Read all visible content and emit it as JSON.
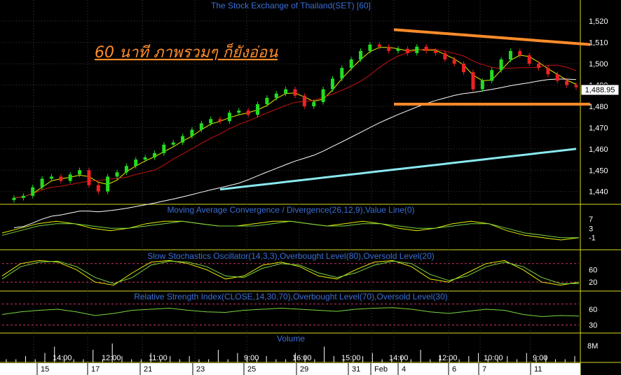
{
  "colors": {
    "background": "#000000",
    "frame": "#d8d820",
    "grid": "#3c3c3c",
    "up_candle": "#22dd22",
    "down_candle": "#ee2222",
    "ma_short": "#e8f000",
    "ma_mid": "#cc1111",
    "ma_long": "#ffffff",
    "ma_longest": "#8ae8f0",
    "trendline": "#ff8c2a",
    "indicator_line1": "#e8f000",
    "indicator_line2": "#7ad640",
    "level_line": "#cc3366",
    "title_text": "#3b6fd6"
  },
  "annotation": "60 นาที ภาพรวมๆ ก็ยังอ่อน",
  "chart_data": [
    {
      "type": "candlestick",
      "title": "The Stock Exchange of Thailand(SET) [60]",
      "y_ticks": [
        "1,520",
        "1,510",
        "1,500",
        "1,490",
        "1,480",
        "1,470",
        "1,460",
        "1,450",
        "1,440"
      ],
      "ylim": [
        1434,
        1524
      ],
      "last_price": "1,488.95",
      "x_time_labels": [
        "14:00",
        "12:00",
        "11:00",
        "9:00",
        "16:00",
        "15:00",
        "14:00",
        "12:00",
        "10:00",
        "9:00"
      ],
      "x_date_labels": [
        "15",
        "17",
        "21",
        "23",
        "25",
        "29",
        "31",
        "Feb",
        "4",
        "6",
        "7",
        "11"
      ],
      "close": [
        1437,
        1438,
        1442,
        1446,
        1447,
        1445,
        1448,
        1450,
        1443,
        1440,
        1447,
        1449,
        1452,
        1455,
        1456,
        1458,
        1462,
        1463,
        1466,
        1469,
        1472,
        1474,
        1473,
        1477,
        1478,
        1476,
        1481,
        1484,
        1486,
        1488,
        1485,
        1480,
        1482,
        1488,
        1493,
        1498,
        1502,
        1506,
        1509,
        1508,
        1506,
        1507,
        1505,
        1508,
        1506,
        1505,
        1502,
        1500,
        1496,
        1488,
        1492,
        1497,
        1502,
        1506,
        1504,
        1500,
        1498,
        1495,
        1492,
        1490,
        1489
      ],
      "trendlines": [
        {
          "from": [
            0.0,
            1516
          ],
          "to": [
            1.0,
            1509
          ]
        },
        {
          "from": [
            0.0,
            1481
          ],
          "to": [
            1.0,
            1481
          ]
        }
      ]
    },
    {
      "type": "line",
      "title": "Moving Average Convergence / Divergence(26,12,9),Value Line(0)",
      "y_ticks": [
        "7",
        "3",
        "-1"
      ],
      "ylim": [
        -5,
        10
      ],
      "series": [
        {
          "values": [
            1,
            3,
            5,
            6,
            5,
            3,
            2,
            3,
            5,
            6,
            6,
            5,
            4,
            4,
            5,
            6,
            6,
            5,
            4,
            5,
            6,
            5,
            3,
            2,
            3,
            5,
            6,
            5,
            2,
            0,
            -1,
            -2,
            -1
          ]
        },
        {
          "values": [
            0,
            2,
            4,
            5,
            5,
            4,
            3,
            3,
            4,
            5,
            6,
            5,
            4,
            4,
            4,
            5,
            6,
            5,
            4,
            4,
            5,
            5,
            4,
            3,
            3,
            4,
            5,
            5,
            3,
            1,
            0,
            -1,
            -1
          ]
        }
      ]
    },
    {
      "type": "line",
      "title": "Slow Stochastics Oscillator(14,3,3),Overbought Level(80),Oversold Level(20)",
      "y_ticks": [
        "60",
        "20"
      ],
      "ylim": [
        0,
        100
      ],
      "levels": [
        80,
        20
      ],
      "series": [
        {
          "values": [
            40,
            80,
            90,
            85,
            60,
            20,
            10,
            50,
            85,
            90,
            80,
            60,
            30,
            40,
            75,
            85,
            70,
            40,
            30,
            60,
            85,
            90,
            70,
            30,
            20,
            50,
            80,
            90,
            60,
            20,
            10,
            20
          ]
        },
        {
          "values": [
            30,
            70,
            85,
            88,
            70,
            35,
            15,
            35,
            75,
            88,
            85,
            70,
            40,
            35,
            65,
            80,
            75,
            50,
            35,
            50,
            75,
            88,
            80,
            45,
            25,
            40,
            70,
            85,
            70,
            35,
            15,
            15
          ]
        }
      ]
    },
    {
      "type": "line",
      "title": "Relative Strength Index(CLOSE,14,30,70),Overbought Level(70),Oversold Level(30)",
      "y_ticks": [
        "60",
        "30"
      ],
      "ylim": [
        20,
        80
      ],
      "levels": [
        70,
        30
      ],
      "series": [
        {
          "values": [
            50,
            55,
            58,
            60,
            55,
            48,
            52,
            58,
            60,
            62,
            58,
            55,
            54,
            58,
            60,
            62,
            60,
            58,
            56,
            60,
            62,
            63,
            60,
            55,
            52,
            56,
            60,
            58,
            50,
            46,
            48,
            47
          ]
        }
      ]
    },
    {
      "type": "bar",
      "title": "Volume",
      "y_ticks": [
        "8M"
      ],
      "values": [
        1,
        1,
        2,
        1,
        3,
        5,
        2,
        1,
        1,
        4,
        1,
        6,
        2,
        1,
        1,
        3,
        1,
        2,
        1,
        2,
        1,
        1,
        4,
        1,
        3,
        2,
        1,
        2,
        1,
        1,
        3,
        2,
        1,
        5,
        2,
        1,
        1,
        2,
        3,
        1,
        1,
        2,
        1,
        4,
        1,
        2,
        1,
        1,
        2,
        3,
        1,
        1,
        2,
        1,
        3,
        1,
        2,
        1,
        1,
        2
      ]
    }
  ]
}
